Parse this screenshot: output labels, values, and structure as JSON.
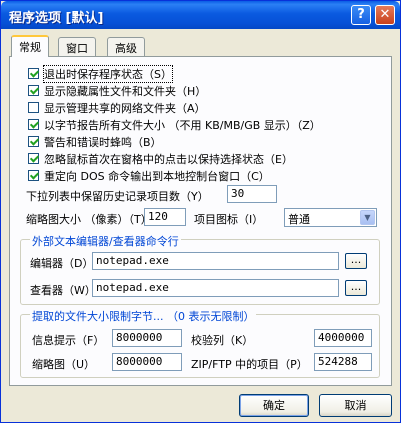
{
  "window": {
    "title": "程序选项 [默认]",
    "help_button": "?",
    "close_button": "✕"
  },
  "tabs": [
    {
      "label": "常规",
      "active": true
    },
    {
      "label": "窗口",
      "active": false
    },
    {
      "label": "高级",
      "active": false
    }
  ],
  "checkboxes": [
    {
      "label": "退出时保存程序状态（S）",
      "checked": true
    },
    {
      "label": "显示隐藏属性文件和文件夹（H）",
      "checked": true
    },
    {
      "label": "显示管理共享的网络文件夹（A）",
      "checked": false
    },
    {
      "label": "以字节报告所有文件大小 （不用 KB/MB/GB 显示）（Z）",
      "checked": true
    },
    {
      "label": "警告和错误时蜂鸣（B）",
      "checked": true
    },
    {
      "label": "忽略鼠标首次在窗格中的点击以保持选择状态（E）",
      "checked": true
    },
    {
      "label": "重定向 DOS 命令输出到本地控制台窗口（C）",
      "checked": true
    }
  ],
  "history": {
    "label": "下拉列表中保留历史记录项目数（Y）",
    "value": "30"
  },
  "thumb_size": {
    "label": "缩略图大小 （像素）（T）",
    "value": "120"
  },
  "item_icon": {
    "label": "项目图标（I）",
    "value": "普通"
  },
  "editors": {
    "title": "外部文本编辑器/查看器命令行",
    "editor_label": "编辑器（D）",
    "editor_value": "notepad.exe",
    "viewer_label": "查看器（W）",
    "viewer_value": "notepad.exe",
    "browse": "..."
  },
  "limits": {
    "title": "提取的文件大小限制字节... （0 表示无限制）",
    "info_label": "信息提示（F）",
    "info_value": "8000000",
    "checksum_label": "校验列（K）",
    "checksum_value": "4000000",
    "thumb_label": "缩略图（U）",
    "thumb_value": "8000000",
    "zip_label": "ZIP/FTP 中的项目（P）",
    "zip_value": "524288"
  },
  "buttons": {
    "ok": "确定",
    "cancel": "取消"
  }
}
